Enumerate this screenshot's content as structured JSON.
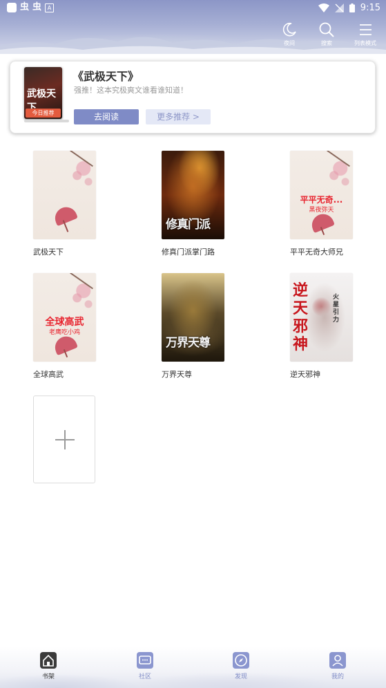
{
  "status_bar": {
    "left_glyph_1": "虫",
    "left_glyph_2": "虫",
    "left_box": "A",
    "time": "9:15"
  },
  "header": {
    "actions": [
      {
        "label": "夜间",
        "icon": "moon-icon"
      },
      {
        "label": "搜索",
        "icon": "search-icon"
      },
      {
        "label": "列表模式",
        "icon": "list-icon"
      }
    ]
  },
  "recommendation": {
    "title": "《武极天下》",
    "subtitle": "强推！这本究极爽文谁看谁知道！",
    "cover_title": "武极天下",
    "ribbon": "今日推荐",
    "read_button": "去阅读",
    "more_button": "更多推荐 >"
  },
  "books": [
    {
      "title": "武极天下",
      "cover_text": "",
      "cover_sub": ""
    },
    {
      "title": "修真门派掌门路",
      "cover_text": "修真门派",
      "cover_sub": ""
    },
    {
      "title": "平平无奇大师兄",
      "cover_text": "平平无奇...",
      "cover_sub": "黑夜弥天"
    },
    {
      "title": "全球高武",
      "cover_text": "全球高武",
      "cover_sub": "老鹰吃小鸡"
    },
    {
      "title": "万界天尊",
      "cover_text": "万界天尊",
      "cover_sub": ""
    },
    {
      "title": "逆天邪神",
      "cover_text": "逆天邪神",
      "cover_sub": "火星引力"
    }
  ],
  "add_tile": {
    "icon": "plus-icon"
  },
  "bottom_nav": [
    {
      "label": "书架",
      "icon": "bookshelf-icon",
      "active": true
    },
    {
      "label": "社区",
      "icon": "community-icon",
      "active": false
    },
    {
      "label": "发现",
      "icon": "compass-icon",
      "active": false
    },
    {
      "label": "我的",
      "icon": "profile-icon",
      "active": false
    }
  ],
  "colors": {
    "accent": "#7f8bc6",
    "accent_light": "#e4e8f6",
    "cover_red": "#e8232e"
  }
}
